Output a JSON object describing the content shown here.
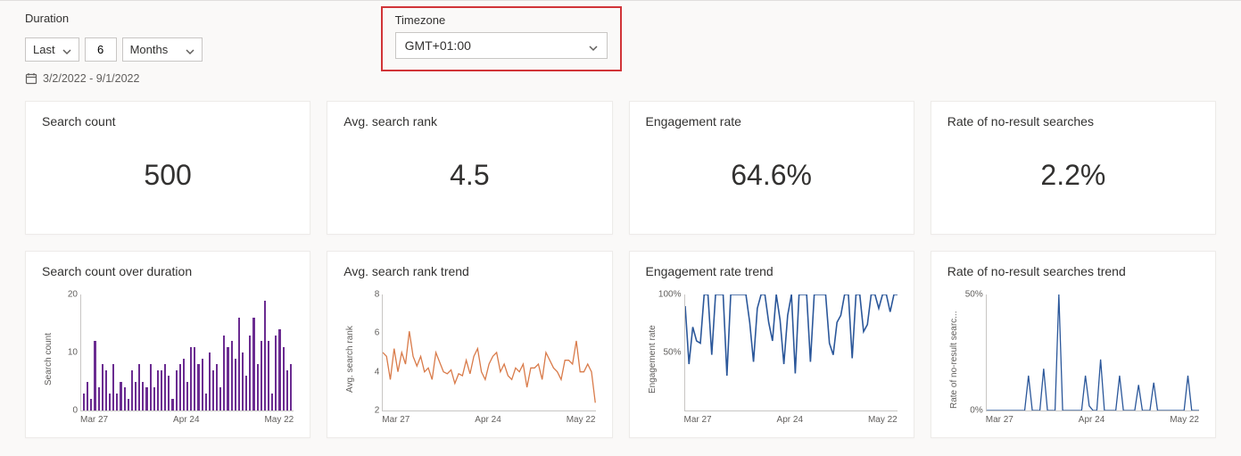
{
  "filters": {
    "duration_label": "Duration",
    "last": "Last",
    "value": "6",
    "unit": "Months",
    "range": "3/2/2022 - 9/1/2022",
    "timezone_label": "Timezone",
    "timezone": "GMT+01:00"
  },
  "metrics": [
    {
      "title": "Search count",
      "value": "500"
    },
    {
      "title": "Avg. search rank",
      "value": "4.5"
    },
    {
      "title": "Engagement rate",
      "value": "64.6%"
    },
    {
      "title": "Rate of no-result searches",
      "value": "2.2%"
    }
  ],
  "charts": [
    {
      "title": "Search count over duration",
      "ylabel": "Search count",
      "x_ticks": [
        "Mar 27",
        "Apr 24",
        "May 22"
      ]
    },
    {
      "title": "Avg. search rank trend",
      "ylabel": "Avg. search rank",
      "x_ticks": [
        "Mar 27",
        "Apr 24",
        "May 22"
      ]
    },
    {
      "title": "Engagement rate trend",
      "ylabel": "Engagement rate",
      "x_ticks": [
        "Mar 27",
        "Apr 24",
        "May 22"
      ]
    },
    {
      "title": "Rate of no-result searches trend",
      "ylabel": "Rate of no-result searc...",
      "x_ticks": [
        "Mar 27",
        "Apr 24",
        "May 22"
      ]
    }
  ],
  "chart_data": [
    {
      "type": "bar",
      "title": "Search count over duration",
      "ylabel": "Search count",
      "ylim": [
        0,
        20
      ],
      "y_ticks": [
        0,
        10,
        20
      ],
      "x_ticks": [
        "Mar 27",
        "Apr 24",
        "May 22"
      ],
      "values": [
        3,
        5,
        2,
        12,
        4,
        8,
        7,
        3,
        8,
        3,
        5,
        4,
        2,
        7,
        5,
        8,
        5,
        4,
        8,
        4,
        7,
        7,
        8,
        6,
        2,
        7,
        8,
        9,
        5,
        11,
        11,
        8,
        9,
        3,
        10,
        7,
        8,
        4,
        13,
        11,
        12,
        9,
        16,
        10,
        6,
        13,
        16,
        8,
        12,
        19,
        12,
        3,
        13,
        14,
        11,
        7,
        8
      ]
    },
    {
      "type": "line",
      "title": "Avg. search rank trend",
      "ylabel": "Avg. search rank",
      "ylim": [
        2,
        8
      ],
      "y_ticks": [
        2,
        4,
        6,
        8
      ],
      "x_ticks": [
        "Mar 27",
        "Apr 24",
        "May 22"
      ],
      "values": [
        5.0,
        4.8,
        3.6,
        5.2,
        4.0,
        5.0,
        4.4,
        6.1,
        4.8,
        4.3,
        4.8,
        4.0,
        4.2,
        3.6,
        5.0,
        4.5,
        4.0,
        3.9,
        4.1,
        3.4,
        3.9,
        3.8,
        4.6,
        3.9,
        4.8,
        5.2,
        4.0,
        3.6,
        4.4,
        4.8,
        5.0,
        4.0,
        4.4,
        3.8,
        3.6,
        4.2,
        4.0,
        4.4,
        3.2,
        4.2,
        4.2,
        4.4,
        3.6,
        5.0,
        4.6,
        4.2,
        4.0,
        3.6,
        4.6,
        4.6,
        4.4,
        5.6,
        4.0,
        4.0,
        4.4,
        4.0,
        2.4
      ]
    },
    {
      "type": "line",
      "title": "Engagement rate trend",
      "ylabel": "Engagement rate",
      "ylim": [
        0,
        100
      ],
      "y_ticks": [
        50,
        100
      ],
      "y_tick_labels": [
        "50%",
        "100%"
      ],
      "x_ticks": [
        "Mar 27",
        "Apr 24",
        "May 22"
      ],
      "values": [
        90,
        40,
        72,
        60,
        58,
        100,
        100,
        48,
        100,
        100,
        100,
        30,
        100,
        100,
        100,
        100,
        100,
        76,
        42,
        88,
        100,
        100,
        76,
        60,
        100,
        78,
        40,
        82,
        100,
        32,
        100,
        100,
        100,
        42,
        100,
        100,
        100,
        100,
        58,
        48,
        76,
        82,
        100,
        100,
        45,
        100,
        100,
        68,
        74,
        100,
        100,
        88,
        100,
        100,
        85,
        100,
        100
      ]
    },
    {
      "type": "line",
      "title": "Rate of no-result searches trend",
      "ylabel": "Rate of no-result searches",
      "ylim": [
        0,
        50
      ],
      "y_ticks": [
        0,
        50
      ],
      "y_tick_labels": [
        "0%",
        "50%"
      ],
      "x_ticks": [
        "Mar 27",
        "Apr 24",
        "May 22"
      ],
      "values": [
        0,
        0,
        0,
        0,
        0,
        0,
        0,
        0,
        0,
        0,
        0,
        15,
        0,
        0,
        0,
        18,
        0,
        0,
        0,
        50,
        0,
        0,
        0,
        0,
        0,
        0,
        15,
        2,
        0,
        0,
        22,
        0,
        0,
        0,
        0,
        15,
        0,
        0,
        0,
        0,
        11,
        0,
        0,
        0,
        12,
        0,
        0,
        0,
        0,
        0,
        0,
        0,
        0,
        15,
        0,
        0,
        0
      ]
    }
  ]
}
